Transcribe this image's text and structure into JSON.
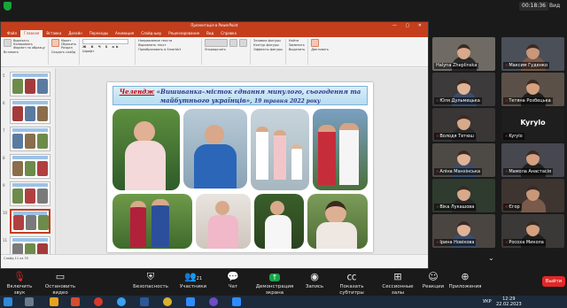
{
  "meeting": {
    "timer": "00:18:36",
    "view_label": "Вид"
  },
  "ppt": {
    "title": "Презентація в PowerPoint",
    "tabs": [
      "Файл",
      "Главная",
      "Вставка",
      "Дизайн",
      "Переходы",
      "Анимация",
      "Слайд-шоу",
      "Рецензирование",
      "Вид",
      "Справка"
    ],
    "active_tab_index": 1,
    "ribbon": {
      "paste": "Вставить",
      "cut": "Вырезать",
      "copy": "Копировать",
      "format": "Формат по образцу",
      "new_slide": "Создать слайд",
      "layout": "Макет",
      "reset": "Сбросить",
      "section": "Раздел",
      "text_direction": "Направление текста",
      "align_text": "Выровнять текст",
      "smartart": "Преобразовать в SmartArt",
      "arrange": "Упорядочить",
      "quick_styles": "Экспресс-стили",
      "shape_fill": "Заливка фигуры",
      "shape_outline": "Контур фигуры",
      "shape_effects": "Эффекты фигуры",
      "find": "Найти",
      "replace": "Заменить",
      "select": "Выделить",
      "dictate": "Диктовать",
      "group_clipboard": "Буфер обмена",
      "group_slides": "Слайды",
      "group_font": "Шрифт",
      "group_paragraph": "Абзац",
      "group_drawing": "Рисование",
      "group_editing": "Редактирование"
    },
    "status": "Слайд 11 из 33",
    "slide": {
      "title_prefix": "Челендж",
      "title_main": "«Вишиванка–місток єднання минулого, сьогодення та майбутнього українців»,",
      "date": "19 травня 2022 року"
    }
  },
  "participants": [
    {
      "name": "Halyna Zheplinska",
      "muted": false
    },
    {
      "name": "Максим Гуденко",
      "muted": true
    },
    {
      "name": "Юля Дульмецька",
      "muted": true
    },
    {
      "name": "Тетяна Розбецька",
      "muted": true
    },
    {
      "name": "Володя Тетюш",
      "muted": true
    },
    {
      "name": "Kyrylo",
      "muted": true,
      "initials": "Kyrylo"
    },
    {
      "name": "Аліна Манзінська",
      "muted": true
    },
    {
      "name": "Мамола Анастасія",
      "muted": true
    },
    {
      "name": "Віка Лукашова",
      "muted": true
    },
    {
      "name": "Єгор",
      "muted": true
    },
    {
      "name": "Ірина Новікова",
      "muted": true
    },
    {
      "name": "Росоха Микола",
      "muted": true
    }
  ],
  "toolbar": {
    "mute": "Включить звук",
    "video": "Остановить видео",
    "security": "Безопасность",
    "participants": "Участники",
    "participants_count": "21",
    "chat": "Чат",
    "share": "Демонстрация экрана",
    "record": "Запись",
    "captions": "Показать субтитры",
    "breakout": "Сессионные залы",
    "reactions": "Реакции",
    "apps": "Приложения",
    "end": "Выйти"
  },
  "taskbar": {
    "lang": "УКР",
    "time": "12:29",
    "date": "22.02.2023"
  },
  "colors": {
    "ppt_accent": "#c43e1c",
    "zoom_end": "#e02828",
    "zoom_bg": "#1a1a1a"
  }
}
